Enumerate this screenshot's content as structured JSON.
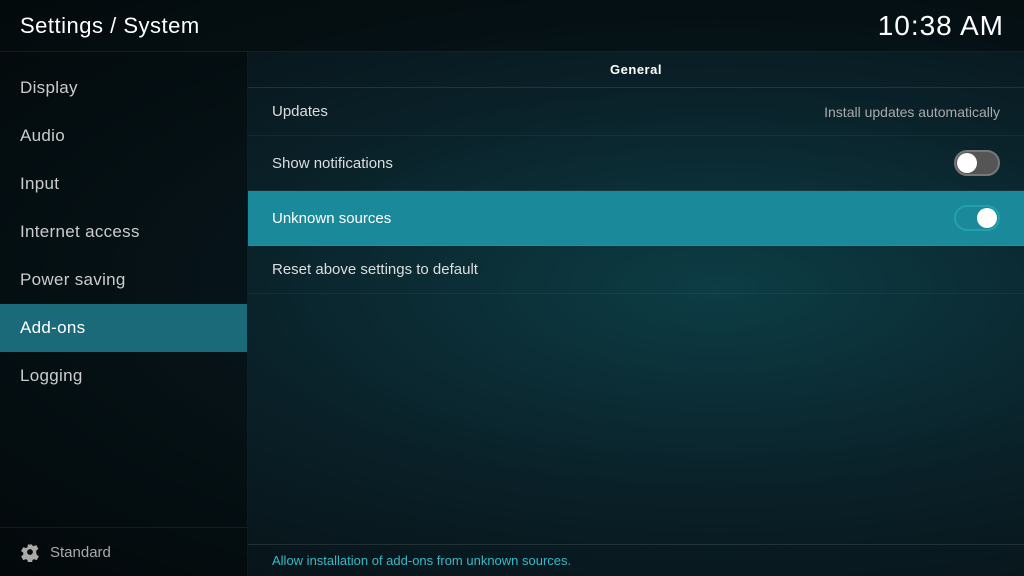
{
  "header": {
    "title": "Settings / System",
    "time": "10:38 AM"
  },
  "sidebar": {
    "items": [
      {
        "id": "display",
        "label": "Display",
        "active": false
      },
      {
        "id": "audio",
        "label": "Audio",
        "active": false
      },
      {
        "id": "input",
        "label": "Input",
        "active": false
      },
      {
        "id": "internet-access",
        "label": "Internet access",
        "active": false
      },
      {
        "id": "power-saving",
        "label": "Power saving",
        "active": false
      },
      {
        "id": "add-ons",
        "label": "Add-ons",
        "active": true
      },
      {
        "id": "logging",
        "label": "Logging",
        "active": false
      }
    ],
    "footer_label": "Standard"
  },
  "content": {
    "section_header": "General",
    "rows": [
      {
        "id": "updates",
        "label": "Updates",
        "value_text": "Install updates automatically",
        "toggle": null,
        "highlighted": false
      },
      {
        "id": "show-notifications",
        "label": "Show notifications",
        "value_text": null,
        "toggle": "off",
        "highlighted": false
      },
      {
        "id": "unknown-sources",
        "label": "Unknown sources",
        "value_text": null,
        "toggle": "on",
        "highlighted": true
      },
      {
        "id": "reset-settings",
        "label": "Reset above settings to default",
        "value_text": null,
        "toggle": null,
        "highlighted": false
      }
    ],
    "footer_hint": "Allow installation of add-ons from unknown sources."
  }
}
